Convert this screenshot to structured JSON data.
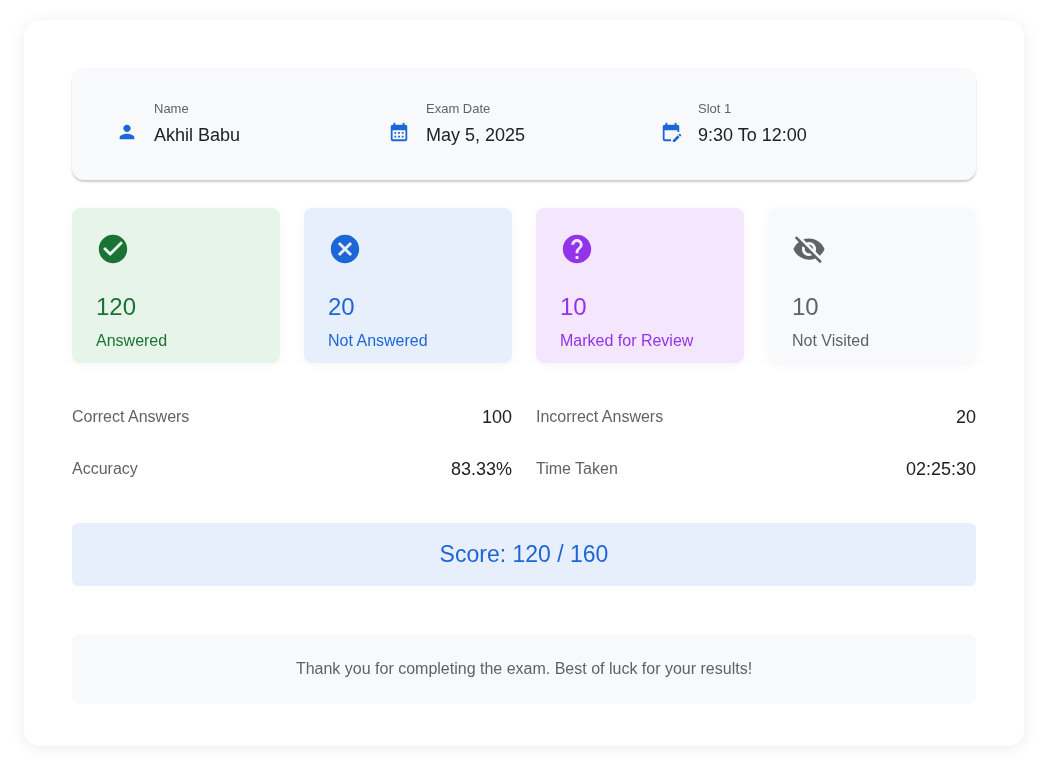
{
  "details": [
    {
      "kind": "person",
      "label": "Name",
      "value": "Akhil Babu"
    },
    {
      "kind": "date",
      "label": "Exam Date",
      "value": "May 5, 2025"
    },
    {
      "kind": "slot",
      "label": "Slot 1",
      "value": "9:30 To 12:00"
    }
  ],
  "stats": [
    {
      "kind": "answered",
      "count": "120",
      "label": "Answered"
    },
    {
      "kind": "not_answered",
      "count": "20",
      "label": "Not Answered"
    },
    {
      "kind": "review",
      "count": "10",
      "label": "Marked for Review"
    },
    {
      "kind": "not_visited",
      "count": "10",
      "label": "Not Visited"
    }
  ],
  "metrics": [
    {
      "label": "Correct Answers",
      "value": "100"
    },
    {
      "label": "Incorrect Answers",
      "value": "20"
    },
    {
      "label": "Accuracy",
      "value": "83.33%"
    },
    {
      "label": "Time Taken",
      "value": "02:25:30"
    }
  ],
  "score": "Score: 120 / 160",
  "message": "Thank you for completing the exam. Best of luck for your results!"
}
